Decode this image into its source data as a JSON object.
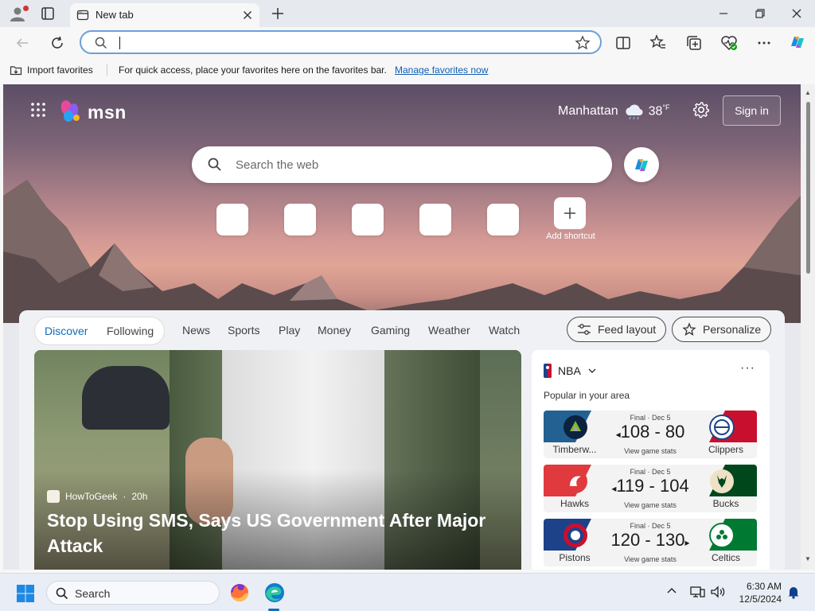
{
  "browser": {
    "tab_title": "New tab",
    "address_value": "",
    "favorites_bar": {
      "import_label": "Import favorites",
      "hint": "For quick access, place your favorites here on the favorites bar.",
      "manage_link": "Manage favorites now"
    }
  },
  "msn": {
    "logo_text": "msn",
    "weather": {
      "location": "Manhattan",
      "temperature": "38",
      "unit": "°F"
    },
    "sign_in": "Sign in",
    "search_placeholder": "Search the web",
    "add_shortcut": "Add shortcut",
    "feed_tabs": {
      "discover": "Discover",
      "following": "Following"
    },
    "nav": [
      "News",
      "Sports",
      "Play",
      "Money",
      "Gaming",
      "Weather",
      "Watch"
    ],
    "feed_layout": "Feed layout",
    "personalize": "Personalize",
    "hero": {
      "source": "HowToGeek",
      "age": "20h",
      "headline": "Stop Using SMS, Says US Government After Major Attack"
    },
    "nba": {
      "league": "NBA",
      "subtitle": "Popular in your area",
      "games": [
        {
          "status": "Final · Dec 5",
          "score": "108 - 80",
          "winner_marker": "◂",
          "home": "Timberw...",
          "away": "Clippers",
          "stats": "View game stats",
          "home_color": "#236192",
          "away_color": "#c8102e"
        },
        {
          "status": "Final · Dec 5",
          "score": "119 - 104",
          "winner_marker": "◂",
          "home": "Hawks",
          "away": "Bucks",
          "stats": "View game stats",
          "home_color": "#e03a3e",
          "away_color": "#00471b"
        },
        {
          "status": "Final · Dec 5",
          "score": "120 - 130",
          "winner_marker": "▸",
          "home": "Pistons",
          "away": "Celtics",
          "stats": "View game stats",
          "home_color": "#1d428a",
          "away_color": "#007a33"
        }
      ]
    }
  },
  "taskbar": {
    "search_label": "Search",
    "time": "6:30 AM",
    "date": "12/5/2024"
  },
  "colors": {
    "accent": "#0f6cbd",
    "address_border": "#6c9fd9"
  }
}
